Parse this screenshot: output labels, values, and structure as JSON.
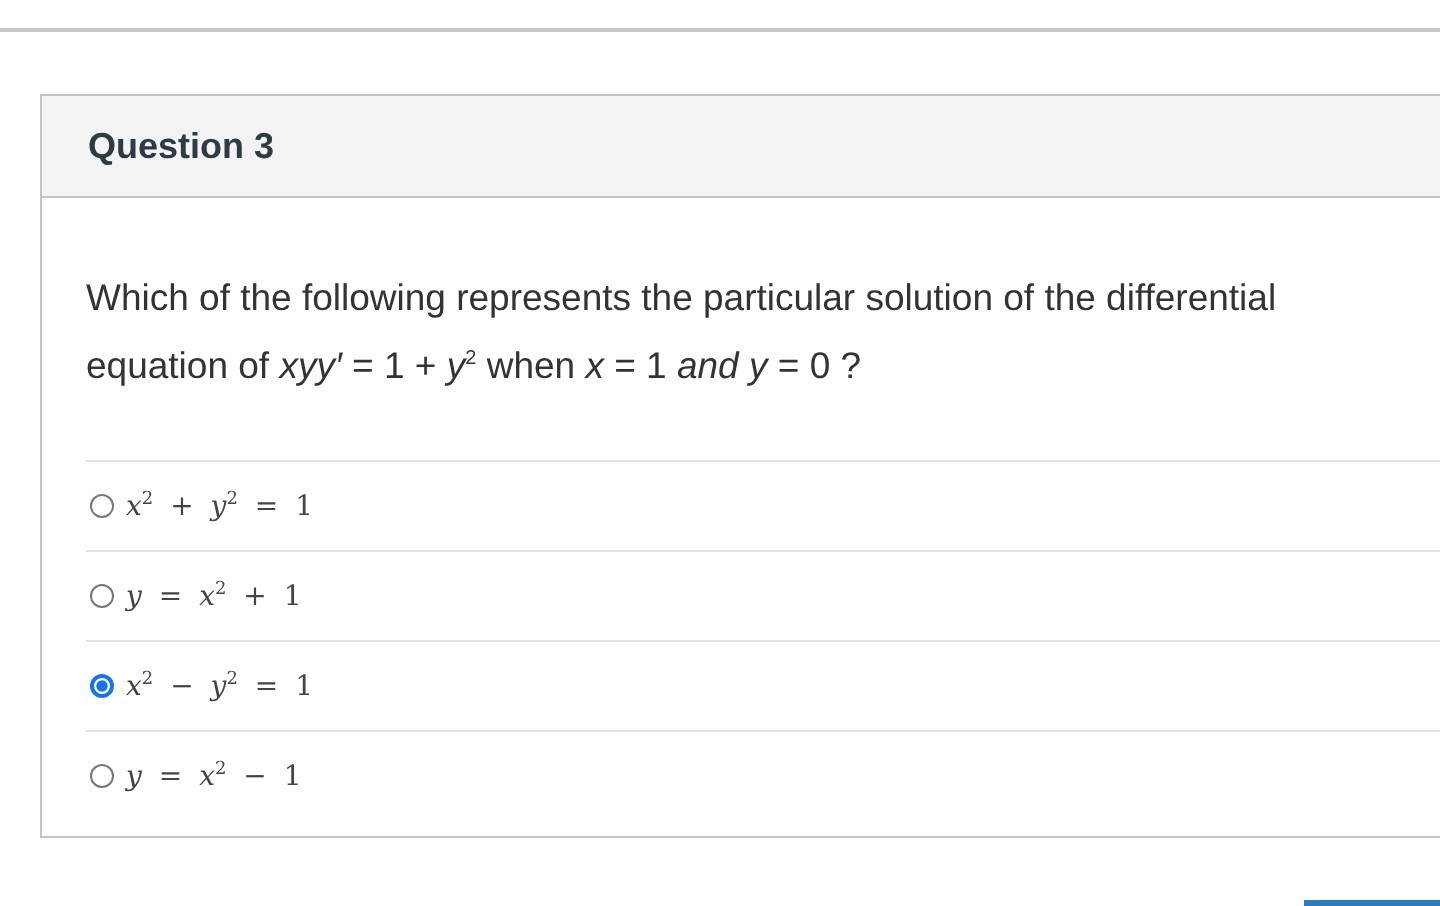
{
  "question": {
    "title": "Question 3",
    "text": "Which of the following represents the particular solution of  the differential equation  of *xyy′* = 1 + *y*$^{2}$   when *x* = 1 *and y* = 0 ?",
    "options": [
      {
        "label": "*x*$^{2}$ + *y*$^{2}$ = 1",
        "selected": false
      },
      {
        "label": "*y* = *x*$^{2}$ + 1",
        "selected": false
      },
      {
        "label": "*x*$^{2}$ − *y*$^{2}$ = 1",
        "selected": true
      },
      {
        "label": "*y* = *x*$^{2}$ − 1",
        "selected": false
      }
    ]
  }
}
